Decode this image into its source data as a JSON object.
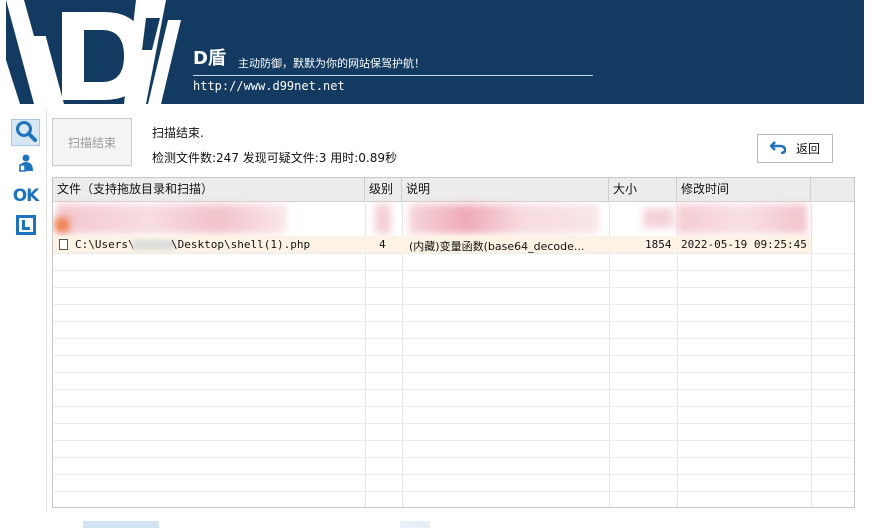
{
  "header": {
    "brand": "D盾",
    "slogan": "主动防御，默默为你的网站保驾护航！",
    "url": "http://www.d99net.net"
  },
  "toolbar": {
    "icons": [
      "search-icon",
      "user-icon",
      "ok-icon",
      "window-icon"
    ],
    "ok_label": "OK"
  },
  "scan": {
    "button_label": "扫描结束",
    "status_line1": "扫描结束.",
    "status_line2": "检测文件数:247 发现可疑文件:3 用时:0.89秒"
  },
  "back_button": {
    "label": "返回",
    "icon": "undo-arrow-icon"
  },
  "table": {
    "columns": [
      "文件（支持拖放目录和扫描）",
      "级别",
      "说明",
      "大小",
      "修改时间"
    ],
    "rows": [
      {
        "file_prefix": "C:\\Users\\",
        "file_suffix": "\\Desktop\\shell(1).php",
        "level": "4",
        "description": "(内藏)变量函数(base64_decode...",
        "size": "1854",
        "modified": "2022-05-19 09:25:45"
      }
    ]
  },
  "colors": {
    "banner": "#133b62",
    "accent": "#1e73be",
    "highlight_row": "#fdf3e4"
  }
}
